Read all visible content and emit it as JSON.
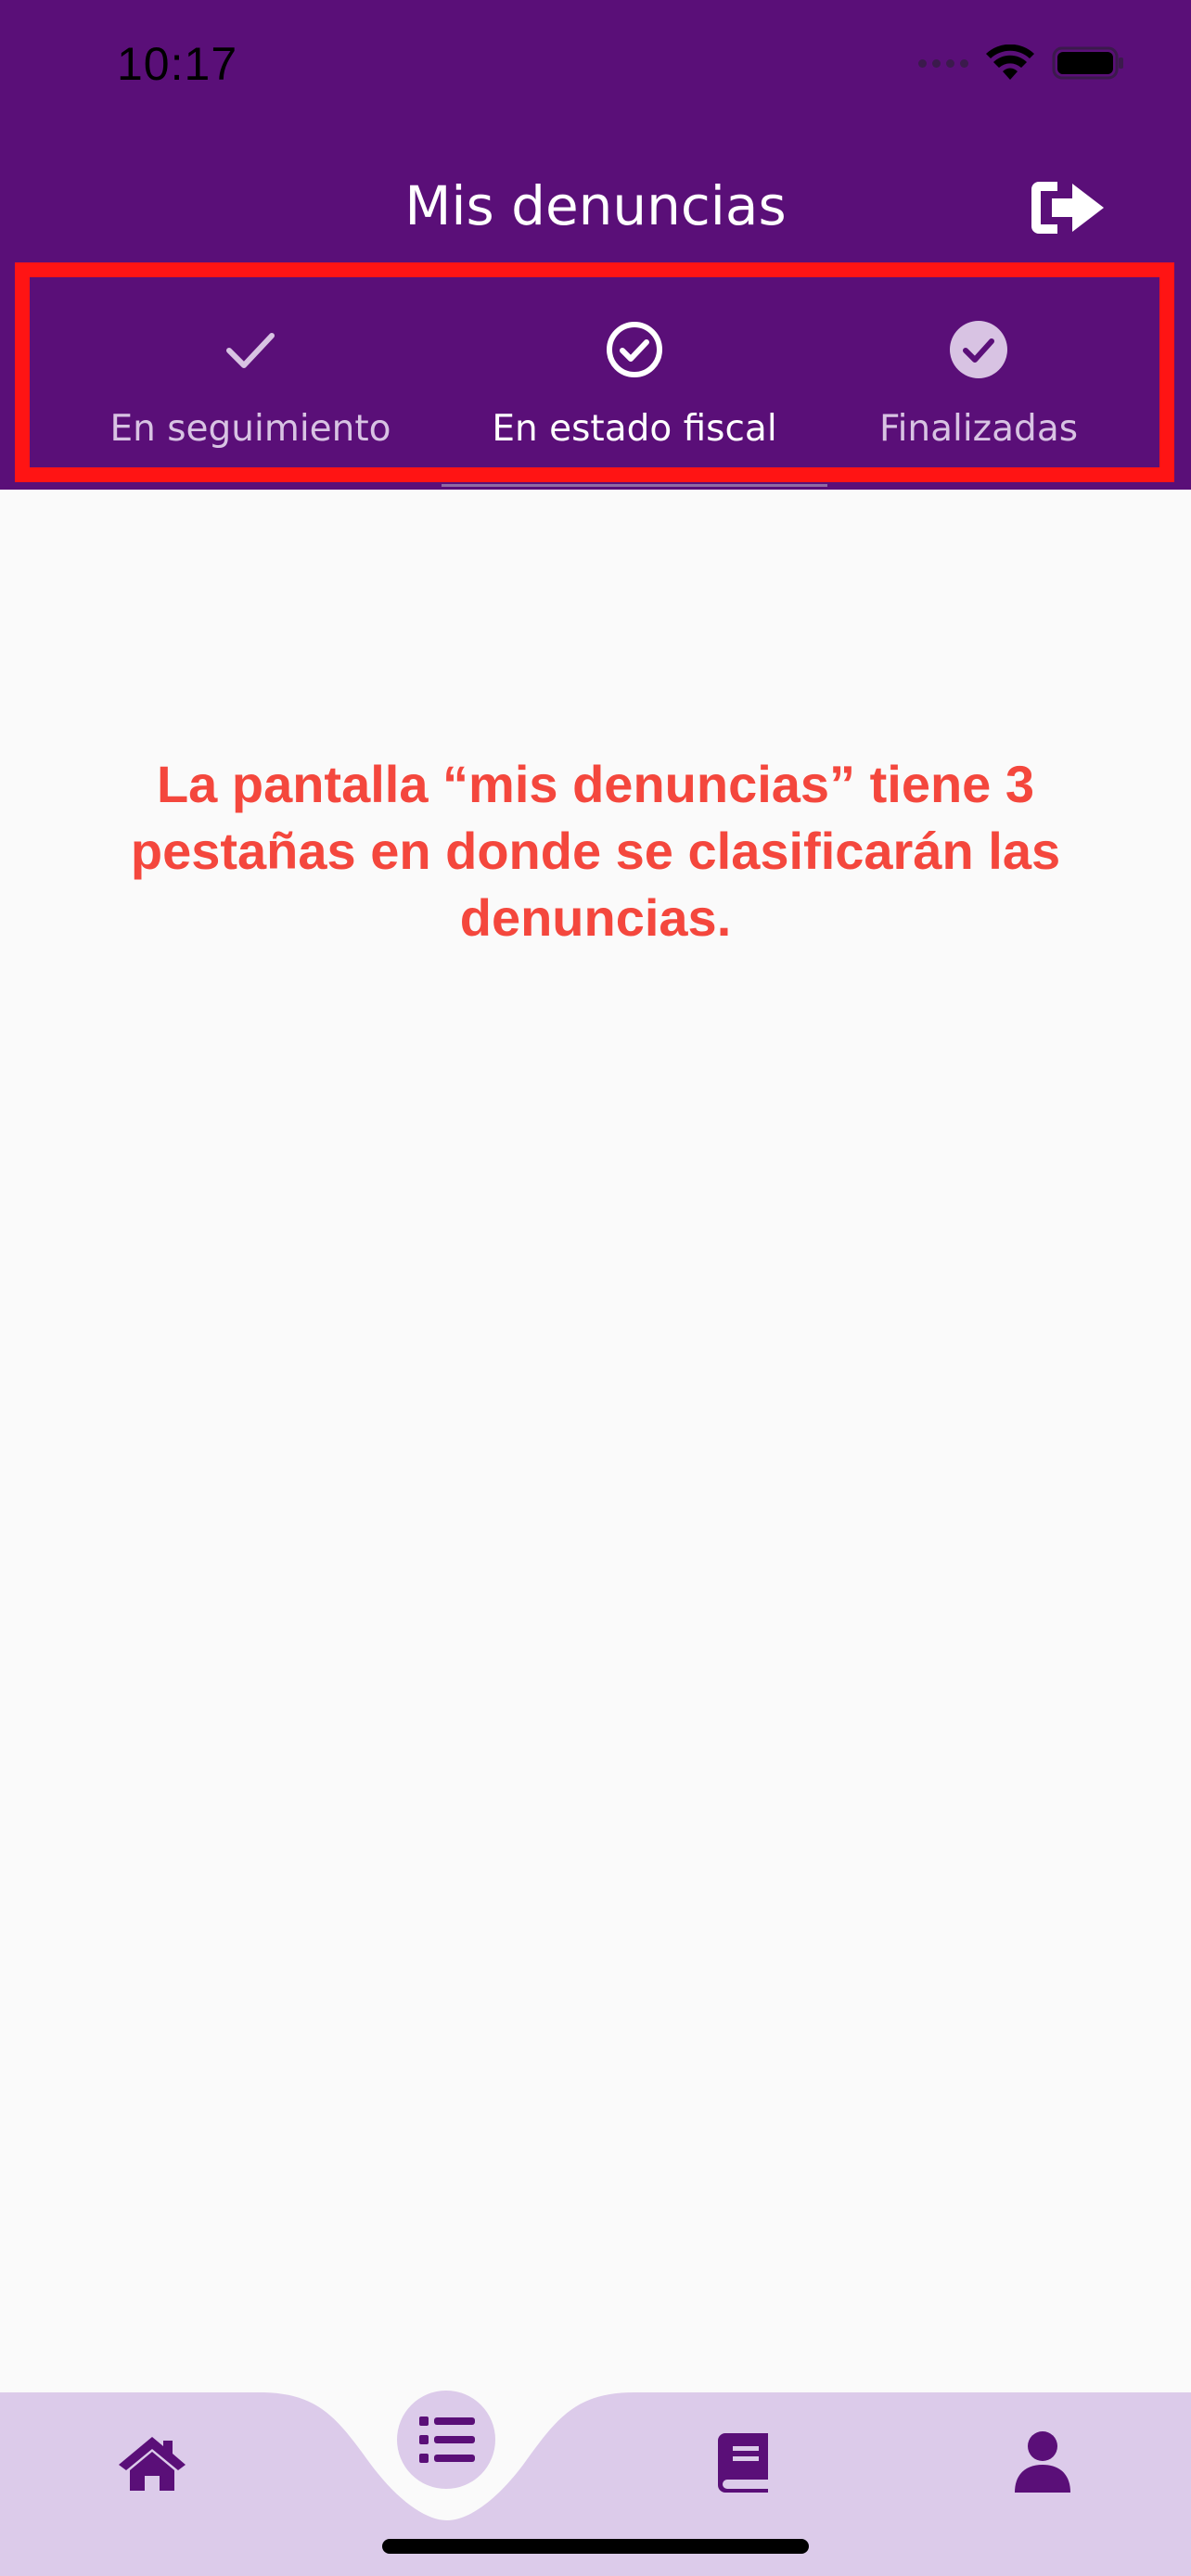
{
  "status_bar": {
    "time": "10:17"
  },
  "header": {
    "title": "Mis denuncias",
    "logout_icon": "logout-arrow-icon"
  },
  "tabs": [
    {
      "label": "En seguimiento",
      "icon": "check-icon",
      "active": false
    },
    {
      "label": "En estado fiscal",
      "icon": "check-circle-outline-icon",
      "active": true
    },
    {
      "label": "Finalizadas",
      "icon": "check-circle-filled-icon",
      "active": false
    }
  ],
  "annotation": {
    "text": "La pantalla “mis denuncias” tiene 3 pestañas en donde se clasificarán las denuncias."
  },
  "bottom_nav": {
    "items": [
      {
        "icon": "home-icon"
      },
      {
        "icon": "list-icon"
      },
      {
        "icon": "book-icon"
      },
      {
        "icon": "profile-icon"
      }
    ]
  },
  "colors": {
    "header_bg": "#5a0f78",
    "annotation": "#f4473d",
    "highlight_border": "#ff1414",
    "nav_bg": "#dccbea",
    "nav_icon": "#5a0f78"
  }
}
